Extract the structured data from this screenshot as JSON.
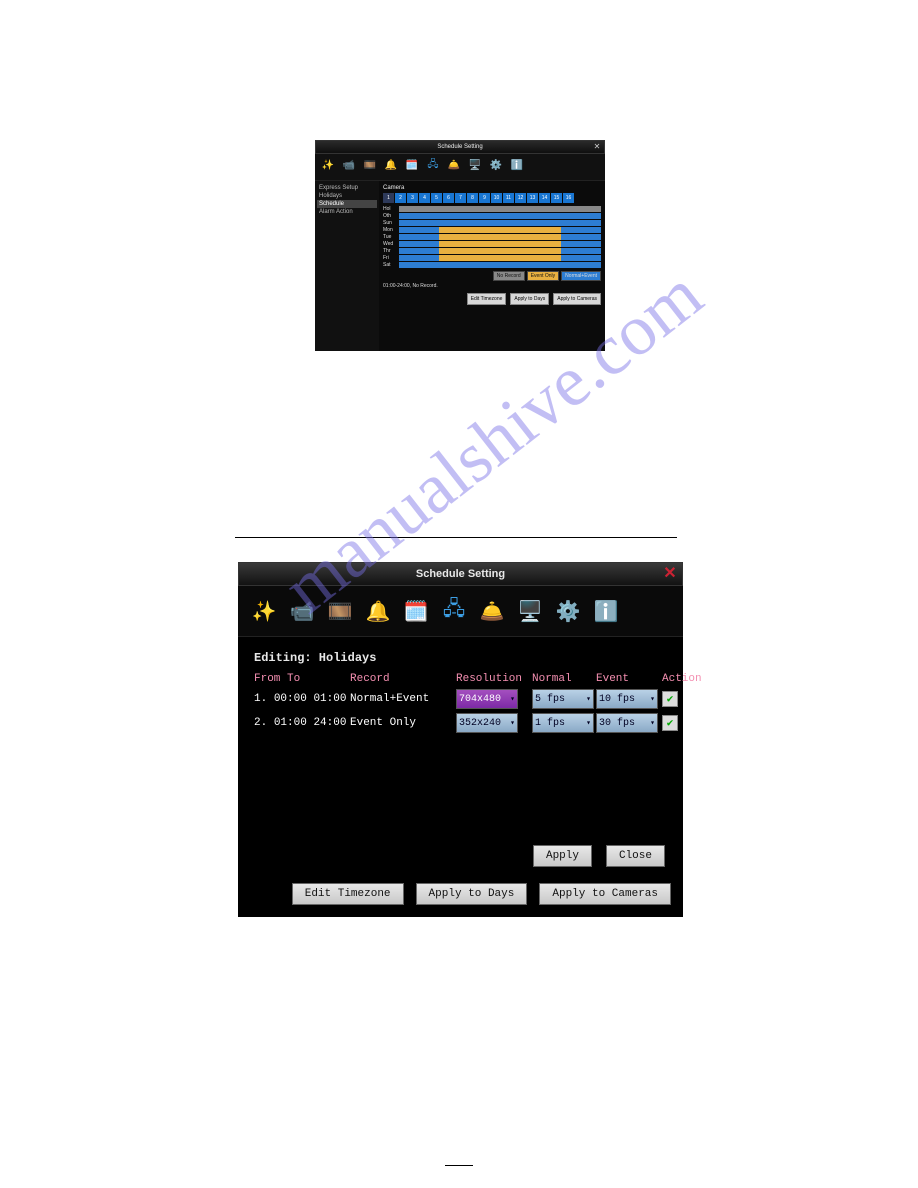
{
  "watermark": "manualshive.com",
  "small": {
    "title": "Schedule Setting",
    "sidebar": [
      "Express Setup",
      "Holidays",
      "Schedule",
      "Alarm Action"
    ],
    "sidebar_selected": 2,
    "camera_label": "Camera",
    "cam_numbers": [
      "1",
      "2",
      "3",
      "4",
      "5",
      "6",
      "7",
      "8",
      "9",
      "10",
      "11",
      "12",
      "13",
      "14",
      "15",
      "16"
    ],
    "days": [
      "Hol",
      "Oth",
      "Sun",
      "Mon",
      "Tue",
      "Wed",
      "Thr",
      "Fri",
      "Sat"
    ],
    "legend": {
      "norecord": "No Record",
      "event": "Event Only",
      "normal": "Normal+Event"
    },
    "status": "01:00-24:00, No Record.",
    "buttons": {
      "edit": "Edit Timezone",
      "days": "Apply to Days",
      "cams": "Apply to Cameras"
    }
  },
  "large": {
    "title": "Schedule Setting",
    "editing": "Editing: Holidays",
    "headers": {
      "fromto": "From  To",
      "record": "Record",
      "resolution": "Resolution",
      "normal": "Normal",
      "event": "Event",
      "action": "Action"
    },
    "rows": [
      {
        "idx": "1.",
        "from": "00:00",
        "to": "01:00",
        "record": "Normal+Event",
        "resolution": "704x480",
        "normal": "5 fps",
        "event": "10 fps",
        "checked": true,
        "hl": true
      },
      {
        "idx": "2.",
        "from": "01:00",
        "to": "24:00",
        "record": "Event Only",
        "resolution": "352x240",
        "normal": "1 fps",
        "event": "30 fps",
        "checked": true,
        "hl": false
      }
    ],
    "apply": "Apply",
    "close": "Close",
    "bottom": {
      "edit": "Edit Timezone",
      "days": "Apply to Days",
      "cams": "Apply to Cameras"
    }
  }
}
